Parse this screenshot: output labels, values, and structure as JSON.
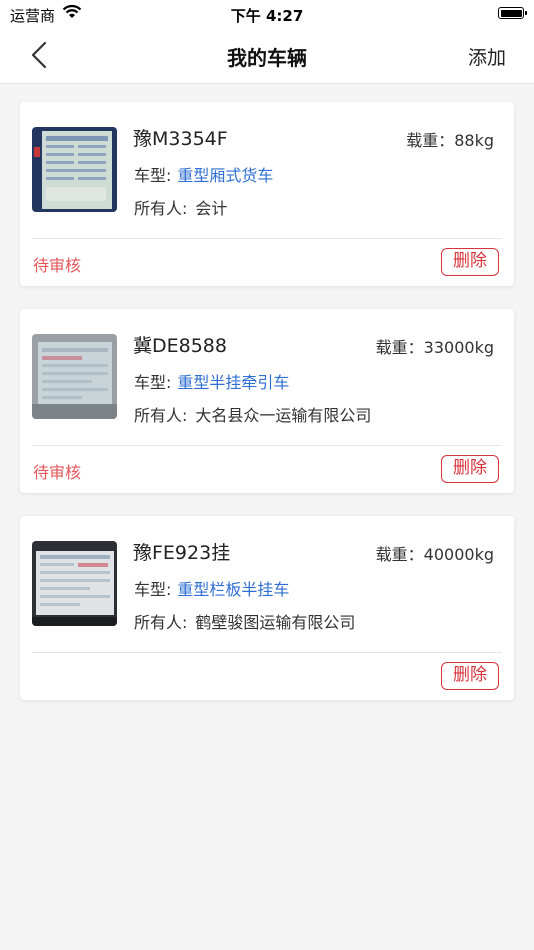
{
  "status_bar": {
    "carrier": "运营商",
    "time": "下午 4:27"
  },
  "nav": {
    "title": "我的车辆",
    "add_label": "添加"
  },
  "labels": {
    "type_prefix": "车型:",
    "owner_prefix": "所有人:",
    "load_prefix": "载重:",
    "delete": "删除"
  },
  "vehicles": [
    {
      "plate": "豫M3354F",
      "load": "载重：88kg",
      "type_label": "车型:",
      "type": "重型厢式货车",
      "owner_label": "所有人:",
      "owner": "会计",
      "status": "待审核",
      "delete_label": "删除"
    },
    {
      "plate": "冀DE8588",
      "load": "载重：33000kg",
      "type_label": "车型:",
      "type": "重型半挂牵引车",
      "owner_label": "所有人:",
      "owner": "大名县众一运输有限公司",
      "status": "待审核",
      "delete_label": "删除"
    },
    {
      "plate": "豫FE923挂",
      "load": "载重：40000kg",
      "type_label": "车型:",
      "type": "重型栏板半挂车",
      "owner_label": "所有人:",
      "owner": "鹤壁骏图运输有限公司",
      "status": "",
      "delete_label": "删除"
    }
  ],
  "colors": {
    "accent_blue": "#2f6fd3",
    "pending_red": "#e4575b",
    "delete_red": "#d8343b"
  }
}
